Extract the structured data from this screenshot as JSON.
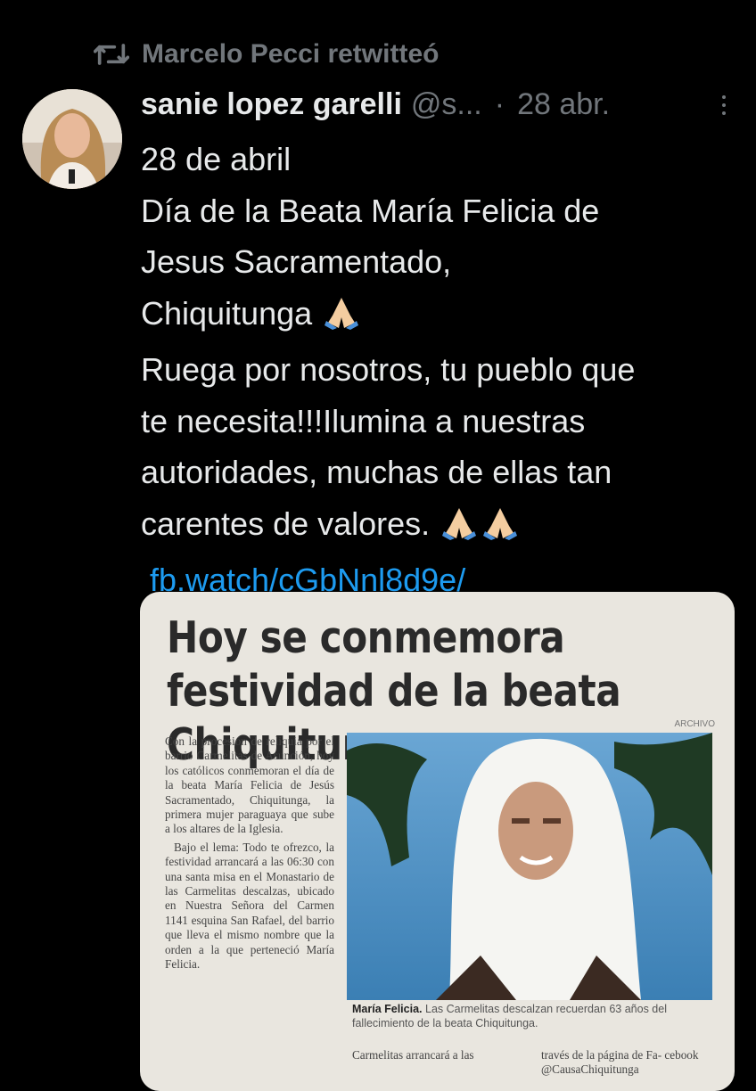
{
  "retweet": {
    "label": "Marcelo Pecci retwitteó",
    "icon": "retweet-icon"
  },
  "tweet": {
    "author_name": "sanie lopez garelli",
    "handle": "@s...",
    "separator": "·",
    "date": "28 abr.",
    "lines": [
      "28 de abril",
      "Día de la Beata María Felicia de",
      "Jesus Sacramentado,",
      "Chiquitunga",
      "Ruega por nosotros, tu pueblo que",
      "te necesita!!!Ilumina a nuestras",
      "autoridades, muchas de ellas tan",
      "carentes de valores."
    ],
    "link": "fb.watch/cGbNnl8d9e/"
  },
  "media": {
    "title": "Hoy se conmemora festividad de la beata Chiquitunga",
    "photo_credit": "ARCHIVO",
    "paragraphs": [
      "Con la procesión de reliquia por el barrio Carmelitas de Asunción, hoy los católicos conmemoran el día de la beata María Felicia de Jesús Sacramentado, Chiquitunga, la primera mujer paraguaya que sube a los altares de la Iglesia.",
      "Bajo el lema: Todo te ofrezco, la festividad arrancará a las 06:30 con una santa misa en el Monastario de las Carmelitas descalzas, ubicado en Nuestra Señora del Carmen 1141 esquina San Rafael, del barrio que lleva el mismo nombre que la orden a la que perteneció María Felicia."
    ],
    "caption_bold": "María Felicia.",
    "caption_text": " Las Carmelitas descalzan recuerdan 63 años del fallecimiento de la beata Chiquitunga.",
    "bottom_left": "Carmelitas arrancará a las",
    "bottom_right": "través de la página de Fa- cebook @CausaChiquitunga"
  }
}
